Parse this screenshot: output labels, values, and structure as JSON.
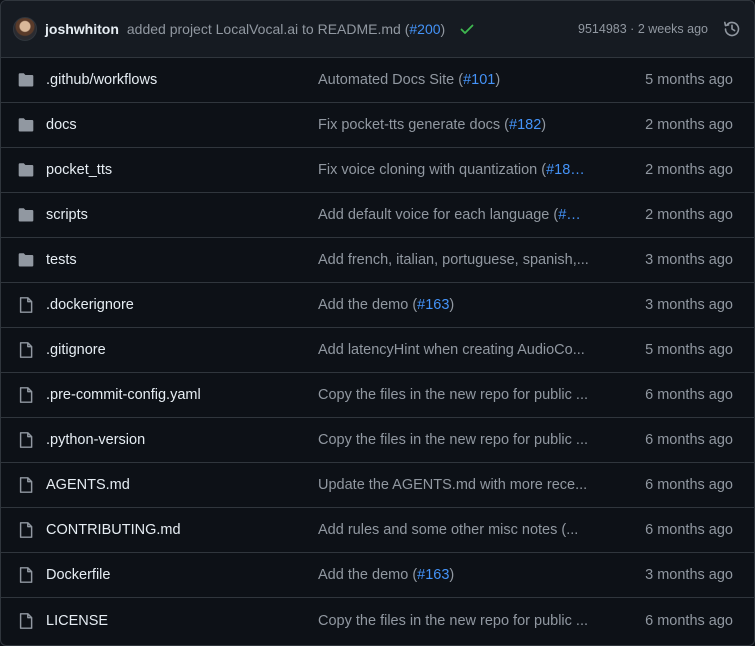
{
  "commit": {
    "author": "joshwhiton",
    "message_prefix": "added project LocalVocal.ai to README.md (",
    "pr": "#200",
    "message_suffix": ")",
    "sha": "9514983",
    "separator": " · ",
    "time": "2 weeks ago",
    "status_icon": "check-icon",
    "history_icon": "history-icon",
    "accent": "#4493f8",
    "success": "#3fb950"
  },
  "entries": [
    {
      "type": "folder",
      "name": ".github/workflows",
      "msg_prefix": "Automated Docs Site (",
      "pr": "#101",
      "msg_suffix": ")",
      "time": "5 months ago"
    },
    {
      "type": "folder",
      "name": "docs",
      "msg_prefix": "Fix pocket-tts generate docs (",
      "pr": "#182",
      "msg_suffix": ")",
      "time": "2 months ago"
    },
    {
      "type": "folder",
      "name": "pocket_tts",
      "msg_prefix": "Fix voice cloning with quantization (",
      "pr": "#18…",
      "msg_suffix": "",
      "time": "2 months ago"
    },
    {
      "type": "folder",
      "name": "scripts",
      "msg_prefix": "Add default voice for each language (",
      "pr": "#…",
      "msg_suffix": "",
      "time": "2 months ago"
    },
    {
      "type": "folder",
      "name": "tests",
      "msg_prefix": "Add french, italian, portuguese, spanish,...",
      "pr": "",
      "msg_suffix": "",
      "time": "3 months ago"
    },
    {
      "type": "file",
      "name": ".dockerignore",
      "msg_prefix": "Add the demo (",
      "pr": "#163",
      "msg_suffix": ")",
      "time": "3 months ago"
    },
    {
      "type": "file",
      "name": ".gitignore",
      "msg_prefix": "Add latencyHint when creating AudioCo...",
      "pr": "",
      "msg_suffix": "",
      "time": "5 months ago"
    },
    {
      "type": "file",
      "name": ".pre-commit-config.yaml",
      "msg_prefix": "Copy the files in the new repo for public ...",
      "pr": "",
      "msg_suffix": "",
      "time": "6 months ago"
    },
    {
      "type": "file",
      "name": ".python-version",
      "msg_prefix": "Copy the files in the new repo for public ...",
      "pr": "",
      "msg_suffix": "",
      "time": "6 months ago"
    },
    {
      "type": "file",
      "name": "AGENTS.md",
      "msg_prefix": "Update the AGENTS.md with more rece...",
      "pr": "",
      "msg_suffix": "",
      "time": "6 months ago"
    },
    {
      "type": "file",
      "name": "CONTRIBUTING.md",
      "msg_prefix": "Add rules and some other misc notes (...",
      "pr": "",
      "msg_suffix": "",
      "time": "6 months ago"
    },
    {
      "type": "file",
      "name": "Dockerfile",
      "msg_prefix": "Add the demo (",
      "pr": "#163",
      "msg_suffix": ")",
      "time": "3 months ago"
    },
    {
      "type": "file",
      "name": "LICENSE",
      "msg_prefix": "Copy the files in the new repo for public ...",
      "pr": "",
      "msg_suffix": "",
      "time": "6 months ago"
    }
  ],
  "icons": {
    "folder": "folder-icon",
    "file": "file-icon"
  }
}
